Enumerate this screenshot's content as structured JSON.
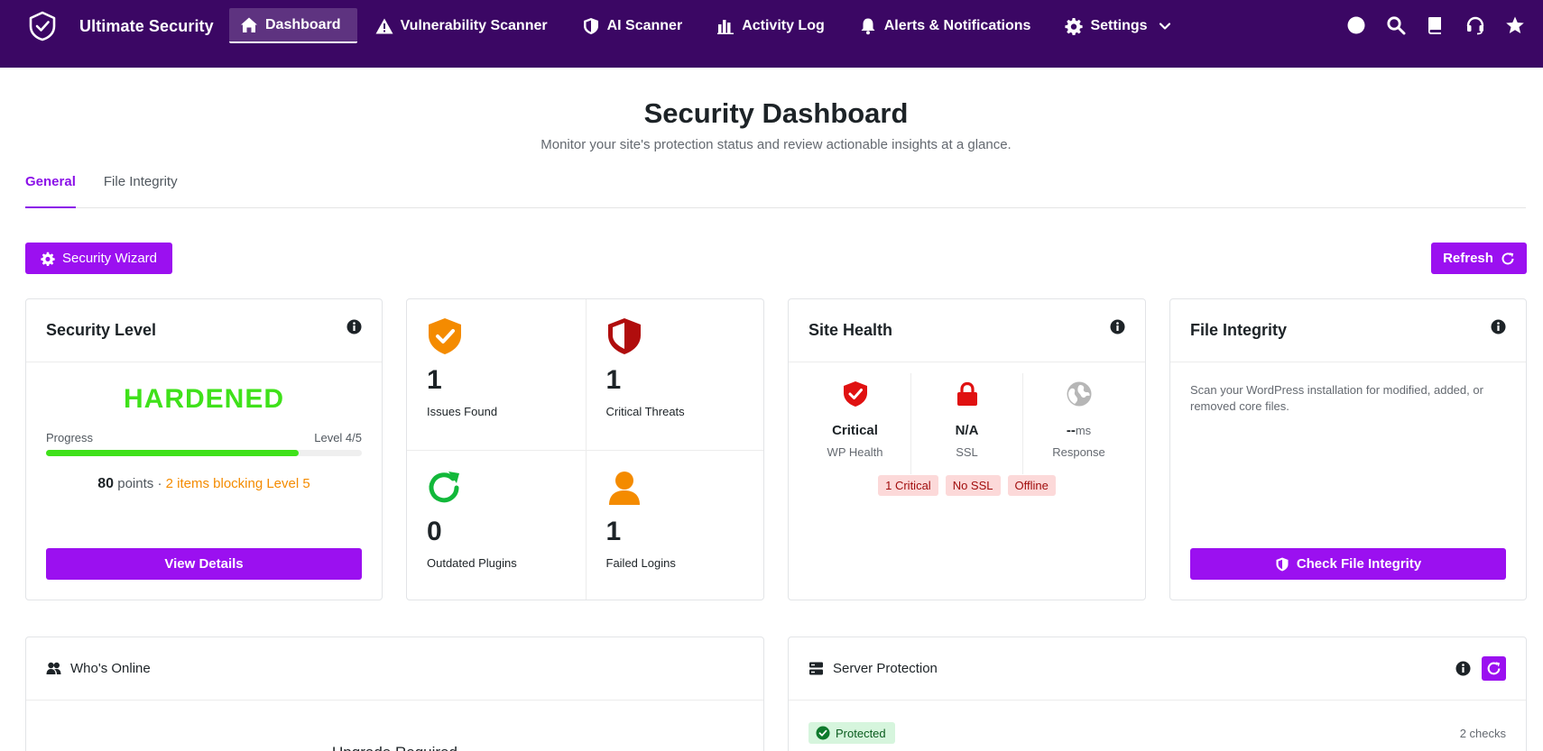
{
  "brand": {
    "name": "Ultimate Security"
  },
  "nav": [
    {
      "label": "Dashboard",
      "icon": "home-icon",
      "active": true
    },
    {
      "label": "Vulnerability Scanner",
      "icon": "warning-icon"
    },
    {
      "label": "AI Scanner",
      "icon": "shield-icon"
    },
    {
      "label": "Activity Log",
      "icon": "bar-chart-icon"
    },
    {
      "label": "Alerts & Notifications",
      "icon": "bell-icon"
    },
    {
      "label": "Settings",
      "icon": "gear-icon"
    }
  ],
  "header": {
    "title": "Security Dashboard",
    "subtitle": "Monitor your site's protection status and review actionable insights at a glance."
  },
  "tabs": [
    {
      "label": "General",
      "active": true
    },
    {
      "label": "File Integrity"
    }
  ],
  "actions": {
    "wizard_label": "Security Wizard",
    "refresh_label": "Refresh"
  },
  "security_level": {
    "title": "Security Level",
    "status": "HARDENED",
    "progress_label": "Progress",
    "level_label": "Level 4/5",
    "progress": 0.8,
    "points": "80",
    "points_suffix": "points",
    "separator": "·",
    "blocking": "2 items blocking Level 5",
    "button": "View Details",
    "status_color": "#3fe11a"
  },
  "stats": [
    {
      "value": "1",
      "label": "Issues Found",
      "icon": "shield-check-icon"
    },
    {
      "value": "1",
      "label": "Critical Threats",
      "icon": "shield-half-icon"
    },
    {
      "value": "0",
      "label": "Outdated Plugins",
      "icon": "refresh-icon"
    },
    {
      "value": "1",
      "label": "Failed Logins",
      "icon": "user-icon"
    }
  ],
  "site_health": {
    "title": "Site Health",
    "cols": [
      {
        "value": "Critical",
        "label": "WP Health",
        "icon": "shield-check-icon"
      },
      {
        "value": "N/A",
        "label": "SSL",
        "icon": "lock-icon"
      },
      {
        "value": "--",
        "unit": "ms",
        "label": "Response",
        "icon": "globe-icon"
      }
    ],
    "badges": [
      "1 Critical",
      "No SSL",
      "Offline"
    ]
  },
  "file_integrity": {
    "title": "File Integrity",
    "description": "Scan your WordPress installation for modified, added, or removed core files.",
    "button": "Check File Integrity"
  },
  "whos_online": {
    "title": "Who's Online",
    "message": "Upgrade Required"
  },
  "server_protection": {
    "title": "Server Protection",
    "status": "Protected",
    "checks": "2 checks"
  },
  "colors": {
    "nav_bg": "#3b0764",
    "accent": "#9b10f0",
    "success": "#3fe11a",
    "warning": "#f48b00",
    "danger": "#d01515"
  }
}
